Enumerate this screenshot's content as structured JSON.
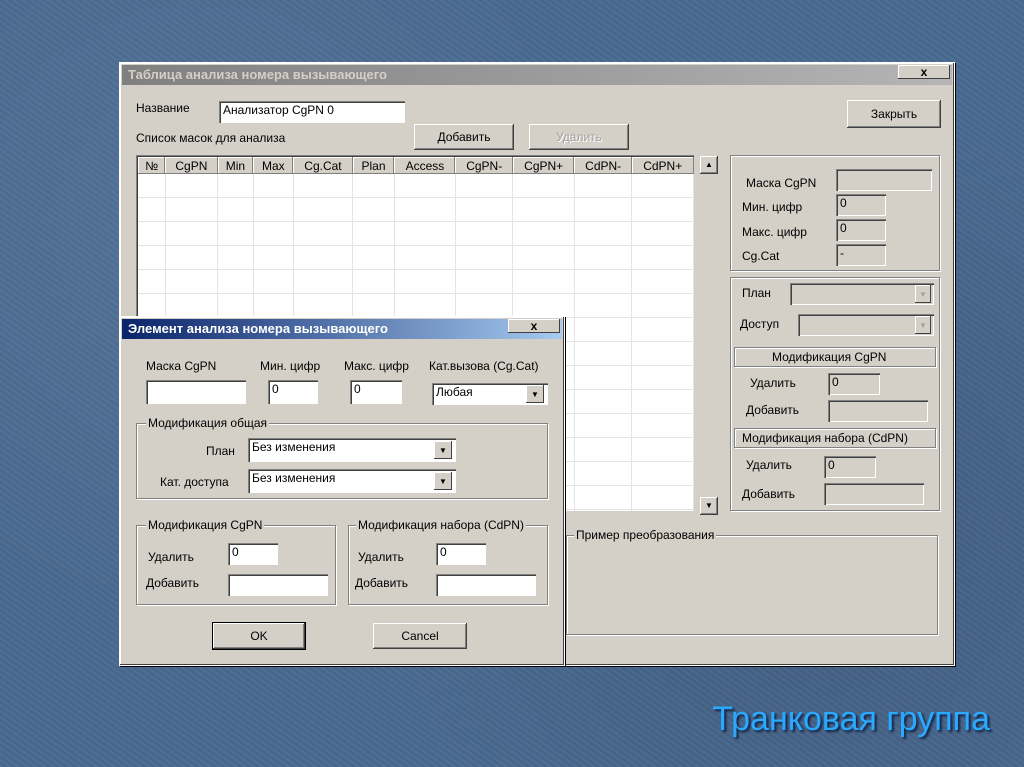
{
  "main_window": {
    "title": "Таблица анализа номера вызывающего",
    "close_glyph": "x",
    "name_label": "Название",
    "name_value": "Анализатор CgPN 0",
    "masks_label": "Список масок для анализа",
    "add_label": "Добавить",
    "delete_label": "Удалить",
    "close_label": "Закрыть",
    "columns": [
      "№",
      "CgPN",
      "Min",
      "Max",
      "Cg.Cat",
      "Plan",
      "Access",
      "CgPN-",
      "CgPN+",
      "CdPN-",
      "CdPN+"
    ],
    "scroll_up": "▲",
    "scroll_down": "▼",
    "right_panel": {
      "mask_label": "Маска CgPN",
      "mask_value": "",
      "min_label": "Мин. цифр",
      "min_value": "0",
      "max_label": "Макс. цифр",
      "max_value": "0",
      "cgcat_label": "Cg.Cat",
      "cgcat_value": "-",
      "plan_label": "План",
      "plan_value": "",
      "access_label": "Доступ",
      "access_value": "",
      "mod_cgpn_title": "Модификация CgPN",
      "mod_cgpn_delete_label": "Удалить",
      "mod_cgpn_delete_value": "0",
      "mod_cgpn_add_label": "Добавить",
      "mod_cgpn_add_value": "",
      "mod_cdpn_title": "Модификация набора (CdPN)",
      "mod_cdpn_delete_label": "Удалить",
      "mod_cdpn_delete_value": "0",
      "mod_cdpn_add_label": "Добавить",
      "mod_cdpn_add_value": ""
    },
    "example_title": "Пример преобразования"
  },
  "dialog": {
    "title": "Элемент анализа номера вызывающего",
    "close_glyph": "x",
    "mask_label": "Маска CgPN",
    "mask_value": "",
    "min_label": "Мин. цифр",
    "min_value": "0",
    "max_label": "Макс. цифр",
    "max_value": "0",
    "cat_label": "Кат.вызова (Cg.Cat)",
    "cat_value": "Любая",
    "general_title": "Модификация общая",
    "plan_label": "План",
    "plan_value": "Без изменения",
    "access_label": "Кат. доступа",
    "access_value": "Без изменения",
    "cgpn_title": "Модификация CgPN",
    "cgpn_delete_label": "Удалить",
    "cgpn_delete_value": "0",
    "cgpn_add_label": "Добавить",
    "cgpn_add_value": "",
    "cdpn_title": "Модификация набора (CdPN)",
    "cdpn_delete_label": "Удалить",
    "cdpn_delete_value": "0",
    "cdpn_add_label": "Добавить",
    "cdpn_add_value": "",
    "ok_label": "OK",
    "cancel_label": "Cancel",
    "arrow": "▼"
  },
  "slide_title": "Транковая группа"
}
